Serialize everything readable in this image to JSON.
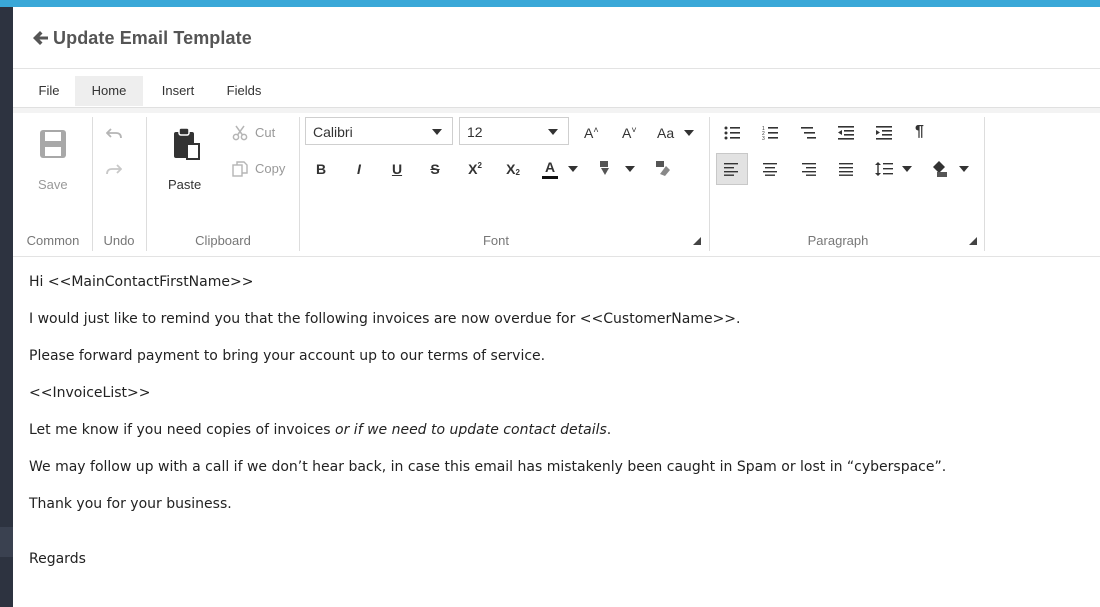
{
  "page": {
    "title": "Update Email Template",
    "accent_color": "#3aa8d8"
  },
  "menu": {
    "items": [
      "File",
      "Home",
      "Insert",
      "Fields"
    ],
    "active": "Home"
  },
  "ribbon": {
    "common": {
      "save_label": "Save",
      "group_label": "Common"
    },
    "undo": {
      "group_label": "Undo"
    },
    "clipboard": {
      "paste_label": "Paste",
      "cut_label": "Cut",
      "copy_label": "Copy",
      "group_label": "Clipboard"
    },
    "font": {
      "family": "Calibri",
      "size": "12",
      "grow_label": "A",
      "shrink_label": "A",
      "case_label": "Aa",
      "bold": "B",
      "italic": "I",
      "underline": "U",
      "strike": "S",
      "superscript": "X",
      "superscript_mark": "2",
      "subscript": "X",
      "subscript_mark": "2",
      "font_color": "A",
      "group_label": "Font"
    },
    "paragraph": {
      "group_label": "Paragraph",
      "pilcrow": "¶"
    }
  },
  "editor": {
    "lines": [
      "Hi <<MainContactFirstName>>",
      "I would just like to remind you that the following invoices are now overdue for <<CustomerName>>.",
      "Please forward payment to bring your account up to our terms of service.",
      "<<InvoiceList>>",
      "We may follow up with a call if we don’t hear back, in case this email has mistakenly been caught in Spam or lost in “cyberspace”.",
      "Thank you for your business.",
      "Regards"
    ],
    "line5_plain": "Let me know if you need copies of invoices ",
    "line5_italic": "or if we need to update contact details",
    "line5_end": "."
  }
}
